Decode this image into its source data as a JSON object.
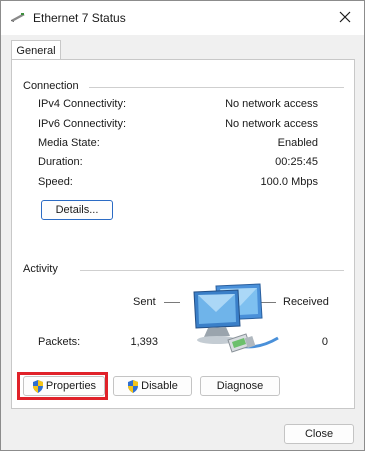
{
  "window": {
    "title": "Ethernet 7 Status",
    "tab_label": "General"
  },
  "connection": {
    "heading": "Connection",
    "rows": [
      {
        "label": "IPv4 Connectivity:",
        "value": "No network access"
      },
      {
        "label": "IPv6 Connectivity:",
        "value": "No network access"
      },
      {
        "label": "Media State:",
        "value": "Enabled"
      },
      {
        "label": "Duration:",
        "value": "00:25:45"
      },
      {
        "label": "Speed:",
        "value": "100.0 Mbps"
      }
    ],
    "details_label": "Details..."
  },
  "activity": {
    "heading": "Activity",
    "sent_label": "Sent",
    "received_label": "Received",
    "packets_label": "Packets:",
    "packets_sent": "1,393",
    "packets_received": "0"
  },
  "actions": {
    "properties_label": "Properties",
    "disable_label": "Disable",
    "diagnose_label": "Diagnose"
  },
  "footer": {
    "close_label": "Close"
  },
  "colors": {
    "highlight": "#e0222a",
    "focus_border": "#2b6bc4"
  }
}
